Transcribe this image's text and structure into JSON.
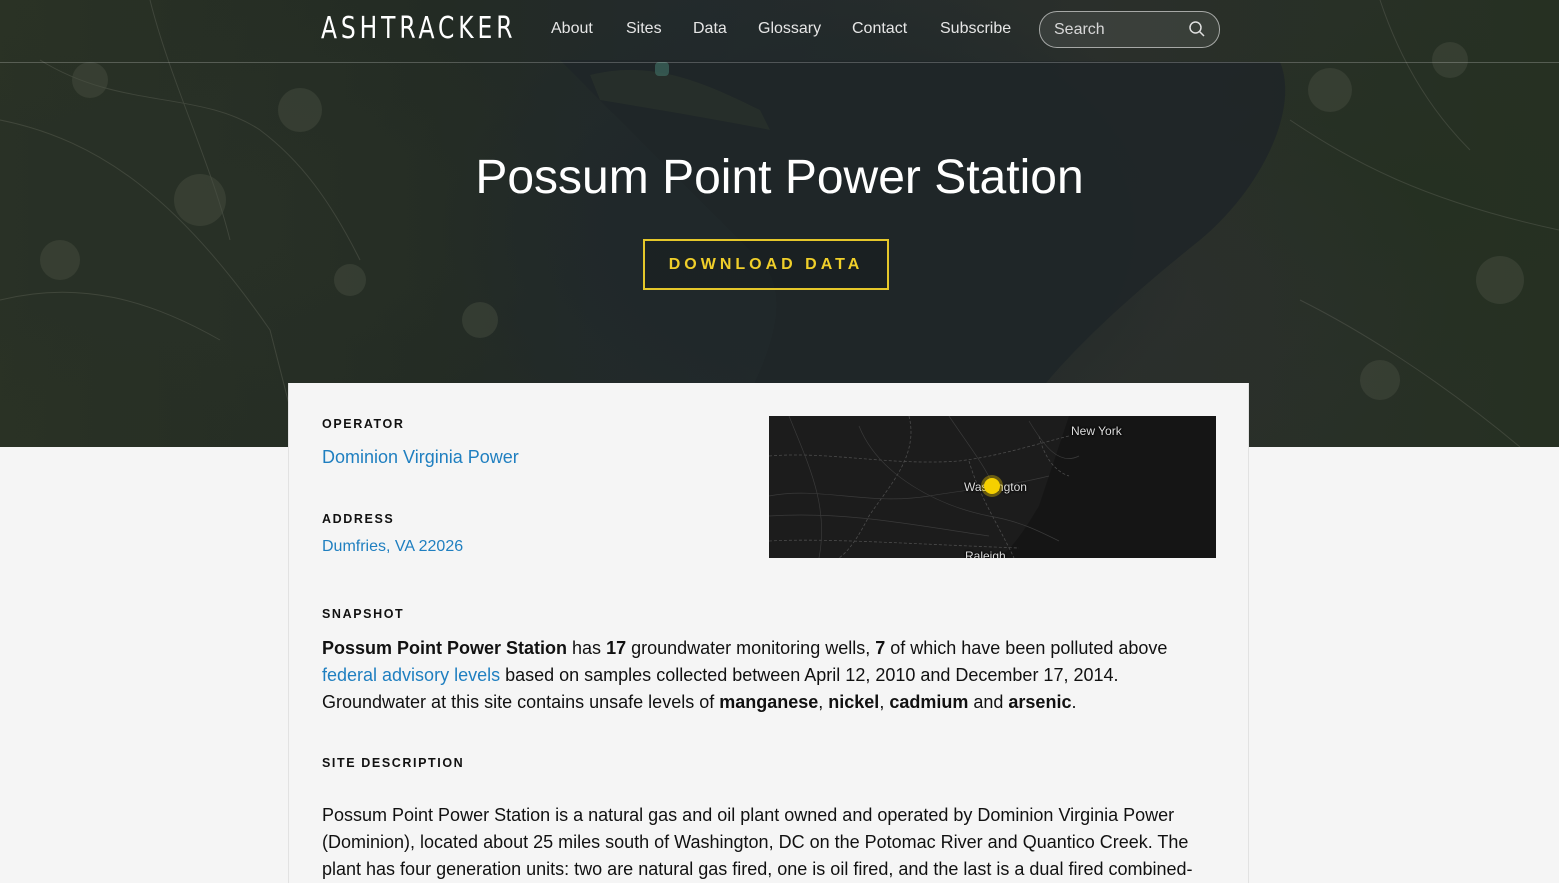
{
  "header": {
    "logo": "ASHTRACKER",
    "nav": [
      {
        "label": "About"
      },
      {
        "label": "Sites"
      },
      {
        "label": "Data"
      },
      {
        "label": "Glossary"
      },
      {
        "label": "Contact"
      },
      {
        "label": "Subscribe"
      }
    ],
    "search": {
      "placeholder": "Search",
      "value": ""
    }
  },
  "hero": {
    "title": "Possum Point Power Station",
    "download_label": "DOWNLOAD DATA"
  },
  "operator": {
    "label": "OPERATOR",
    "value": "Dominion Virginia Power"
  },
  "address": {
    "label": "ADDRESS",
    "value": "Dumfries, VA 22026"
  },
  "map": {
    "labels": {
      "new_york": "New York",
      "washington": "Washington",
      "raleigh": "Raleigh"
    },
    "marker_color": "#f5d000"
  },
  "snapshot": {
    "label": "SNAPSHOT",
    "site_name": "Possum Point Power Station",
    "t1": " has ",
    "wells": "17",
    "t2": " groundwater monitoring wells, ",
    "polluted": "7",
    "t3": " of which have been polluted above ",
    "link_text": "federal advisory levels",
    "t4": " based on samples collected between April 12, 2010 and December 17, 2014. Groundwater at this site contains unsafe levels of ",
    "c1": "manganese",
    "sep1": ", ",
    "c2": "nickel",
    "sep2": ", ",
    "c3": "cadmium",
    "and": " and ",
    "c4": "arsenic",
    "end": "."
  },
  "site_description": {
    "label": "SITE DESCRIPTION",
    "text": "Possum Point Power Station is a natural gas and oil plant owned and operated by Dominion Virginia Power (Dominion), located about 25 miles south of Washington, DC on the Potomac River and Quantico Creek. The plant has four generation units: two are natural gas fired, one is oil fired, and the last is a dual fired combined-"
  },
  "colors": {
    "accent": "#e5c72a",
    "link": "#1f7fc0",
    "background": "#f5f5f5"
  }
}
